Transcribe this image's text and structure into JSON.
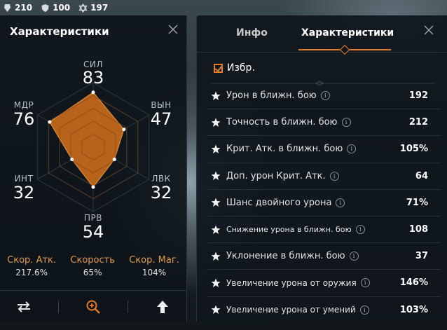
{
  "topbar": {
    "resources": [
      {
        "icon": "stamina-icon",
        "value": "210"
      },
      {
        "icon": "shield-icon",
        "value": "100"
      },
      {
        "icon": "star-of-david-icon",
        "value": "197"
      }
    ]
  },
  "left_panel": {
    "title": "Характеристики",
    "stats": [
      {
        "key": "str",
        "label": "СИЛ",
        "value": "83"
      },
      {
        "key": "con",
        "label": "ВЫН",
        "value": "47"
      },
      {
        "key": "dex",
        "label": "ЛВК",
        "value": "32"
      },
      {
        "key": "per",
        "label": "ПРВ",
        "value": "54"
      },
      {
        "key": "int",
        "label": "ИНТ",
        "value": "32"
      },
      {
        "key": "wis",
        "label": "МДР",
        "value": "76"
      }
    ],
    "radar_fractions": [
      0.85,
      0.55,
      0.38,
      0.62,
      0.38,
      0.78
    ],
    "speeds": [
      {
        "label": "Скор. Атк.",
        "value": "217.6%"
      },
      {
        "label": "Скорость",
        "value": "65%"
      },
      {
        "label": "Скор. Маг.",
        "value": "104%"
      }
    ],
    "colors": {
      "radar_fill": "#c1671b",
      "accent": "#e37d2b"
    }
  },
  "right_panel": {
    "tabs": [
      {
        "label": "Инфо",
        "active": false
      },
      {
        "label": "Характеристики",
        "active": true
      }
    ],
    "favorite_label": "Избр.",
    "favorite_checked": true,
    "rows": [
      {
        "name": "Урон в ближн. бою",
        "value": "192"
      },
      {
        "name": "Точность в ближн. бою",
        "value": "212"
      },
      {
        "name": "Крит. Атк. в ближн. бою",
        "value": "105%"
      },
      {
        "name": "Доп. урон Крит. Атк.",
        "value": "64"
      },
      {
        "name": "Шанс двойного урона",
        "value": "71%"
      },
      {
        "name": "Снижение урона в ближн. бою",
        "value": "108"
      },
      {
        "name": "Уклонение в ближн. бою",
        "value": "37"
      },
      {
        "name": "Увеличение урона от оружия",
        "value": "146%"
      },
      {
        "name": "Увеличение урона от умений",
        "value": "103%"
      }
    ],
    "info_glyph": "i"
  }
}
